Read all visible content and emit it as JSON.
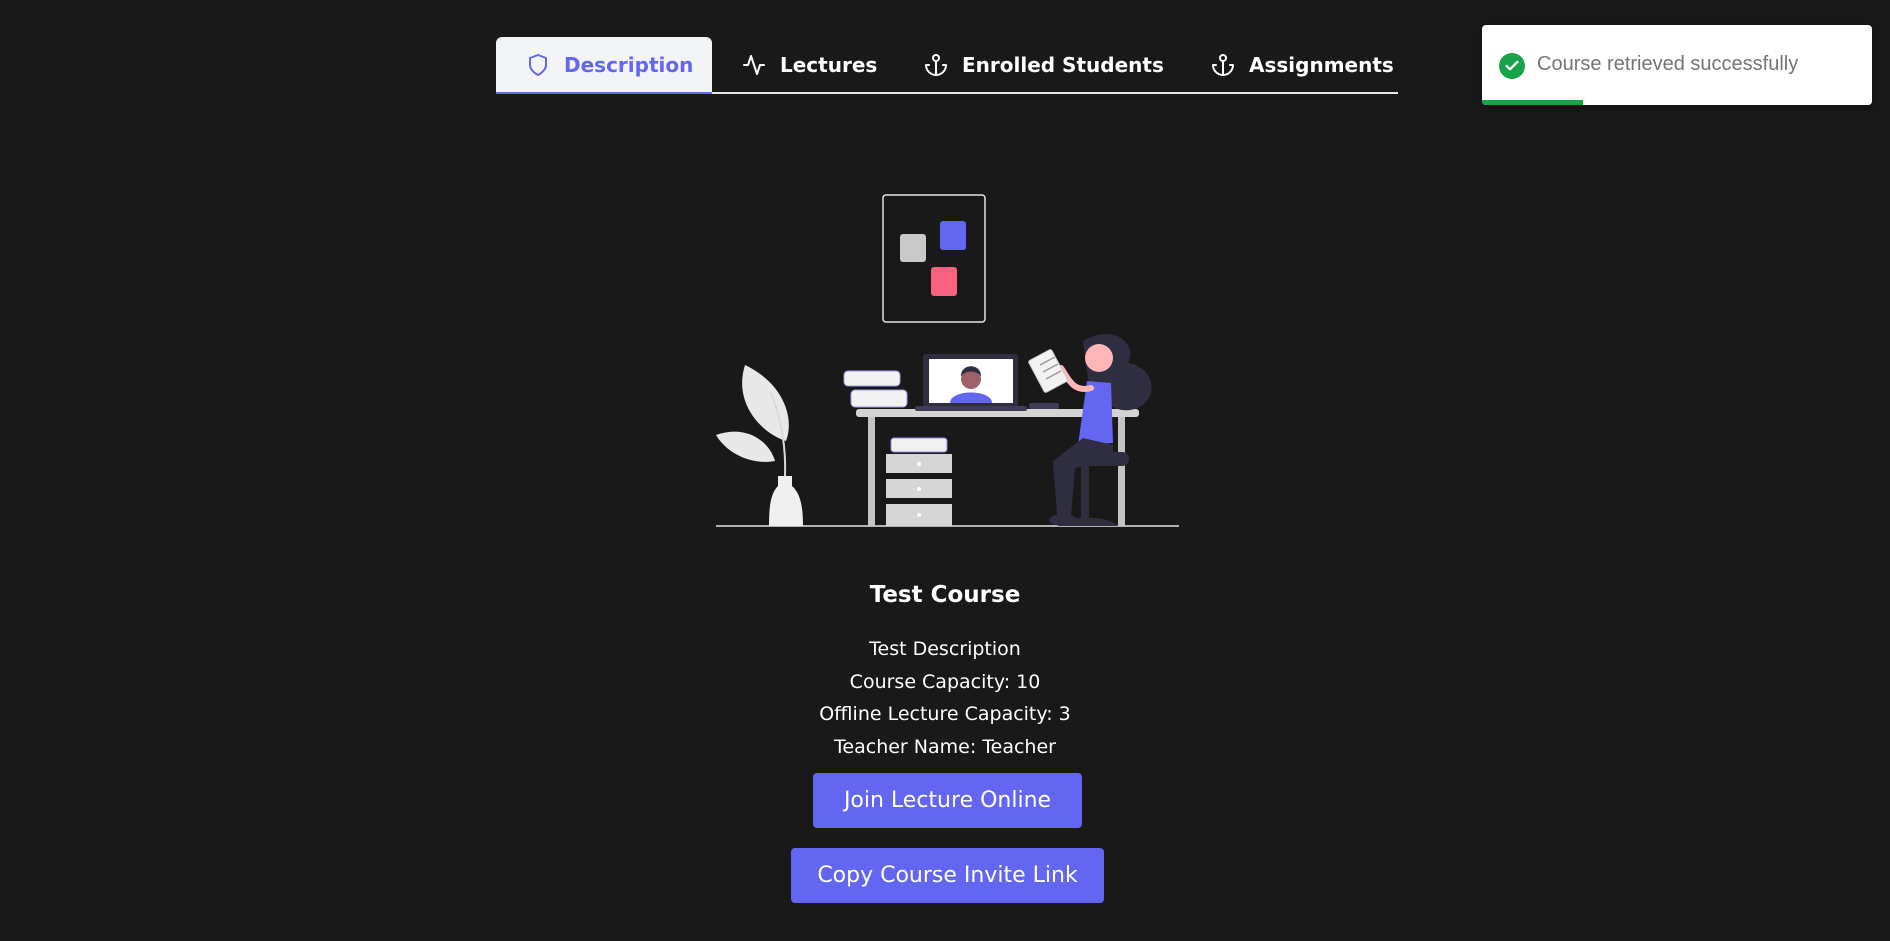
{
  "tabs": [
    {
      "label": "Description",
      "icon": "shield-icon",
      "active": true
    },
    {
      "label": "Lectures",
      "icon": "activity-icon",
      "active": false
    },
    {
      "label": "Enrolled Students",
      "icon": "anchor-icon",
      "active": false
    },
    {
      "label": "Assignments",
      "icon": "anchor-icon",
      "active": false
    }
  ],
  "toast": {
    "message": "Course retrieved successfully",
    "icon": "check-circle-icon",
    "progress": 0.26
  },
  "course": {
    "title": "Test Course",
    "description": "Test Description",
    "capacity_line": "Course Capacity: 10",
    "offline_capacity_line": "Offline Lecture Capacity: 3",
    "teacher_line": "Teacher Name: Teacher"
  },
  "buttons": {
    "join": "Join Lecture Online",
    "copy": "Copy Course Invite Link"
  },
  "colors": {
    "background": "#19191a",
    "accent": "#6366f1",
    "success": "#16a34a",
    "pink": "#f8627f"
  }
}
